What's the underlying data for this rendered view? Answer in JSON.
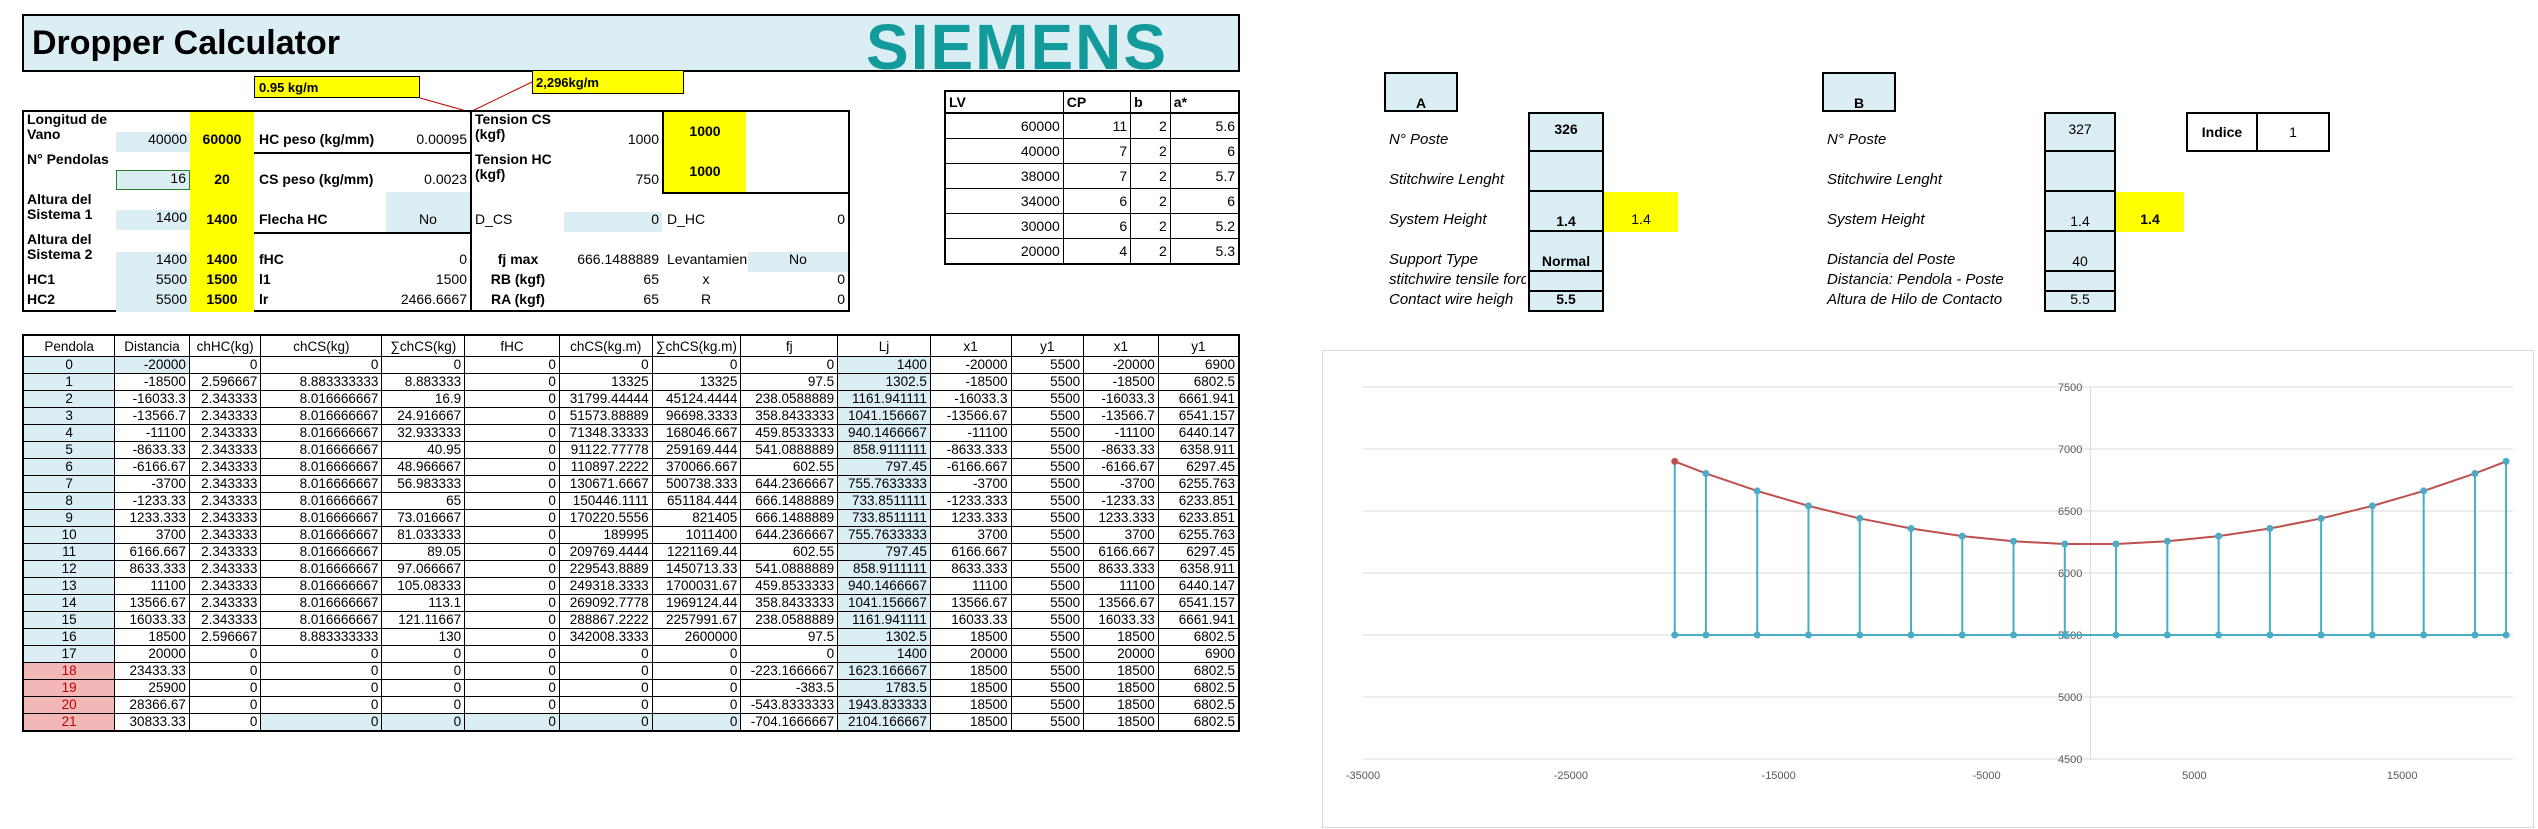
{
  "title": "Dropper Calculator",
  "brand": "SIEMENS",
  "colors": {
    "brand": "#139a9b",
    "cell_blue": "#dbeef4",
    "highlight": "#ffff00",
    "pink": "#f4b7b7",
    "line_blue": "#4bacc6",
    "curve_red": "#c0504d"
  },
  "callouts": {
    "weight_cs": "0.95 kg/m",
    "weight_hc": "2,296kg/m"
  },
  "params": {
    "span_label": "Longitud de Vano",
    "span_val": "40000",
    "span_in": "60000",
    "droppers_label": "N° Pendolas",
    "droppers_val": "16",
    "droppers_in": "20",
    "sys1_label": "Altura del Sistema 1",
    "sys1_val": "1400",
    "sys1_in": "1400",
    "sys2_label": "Altura del Sistema 2",
    "sys2_val": "1400",
    "sys2_in": "1400",
    "hc1_label": "HC1",
    "hc1_val": "5500",
    "hc1_in": "1500",
    "hc2_label": "HC2",
    "hc2_val": "5500",
    "hc2_in": "1500",
    "hc_peso_label": "HC peso (kg/mm)",
    "hc_peso_val": "0.00095",
    "cs_peso_label": "CS peso (kg/mm)",
    "cs_peso_val": "0.0023",
    "flecha_label": "Flecha HC",
    "flecha_val": "No",
    "fhc_label": "fHC",
    "fhc_val": "0",
    "l1_label": "l1",
    "l1_val": "1500",
    "lr_label": "lr",
    "lr_val": "2466.6667",
    "tcs_label": "Tension CS (kgf)",
    "tcs_val": "1000",
    "tcs_in": "1000",
    "thc_label": "Tension HC (kgf)",
    "thc_val": "750",
    "thc_in": "1000",
    "dcs_label": "D_CS",
    "dcs_val": "0",
    "fjmax_label": "fj max",
    "fjmax_val": "666.1488889",
    "rb_label": "RB (kgf)",
    "rb_val": "65",
    "ra_label": "RA (kgf)",
    "ra_val": "65",
    "dhc_label": "D_HC",
    "dhc_val": "0",
    "lev_label": "Levantamien",
    "lev_val": "No",
    "x_label": "x",
    "x_val": "0",
    "r_label": "R",
    "r_val": "0"
  },
  "lv_table": {
    "headers": [
      "LV",
      "CP",
      "b",
      "a*"
    ],
    "rows": [
      [
        "60000",
        "11",
        "2",
        "5.6"
      ],
      [
        "40000",
        "7",
        "2",
        "6"
      ],
      [
        "38000",
        "7",
        "2",
        "5.7"
      ],
      [
        "34000",
        "6",
        "2",
        "6"
      ],
      [
        "30000",
        "6",
        "2",
        "5.2"
      ],
      [
        "20000",
        "4",
        "2",
        "5.3"
      ]
    ]
  },
  "support_a": {
    "header": "A",
    "poste_label": "N° Poste",
    "poste_val": "326",
    "stitch_label": "Stitchwire Lenght",
    "height_label": "System Height",
    "height_val": "1.4",
    "height_yellow": "1.4",
    "type_label": "Support Type",
    "type_val": "Normal",
    "forces_label": "stitchwire tensile forces",
    "contact_label": "Contact wire heigh",
    "contact_val": "5.5"
  },
  "support_b": {
    "header": "B",
    "poste_label": "N° Poste",
    "poste_val": "327",
    "stitch_label": "Stitchwire Lenght",
    "height_label": "System Height",
    "height_val": "1.4",
    "height_yellow": "1.4",
    "dist_label": "Distancia del Poste",
    "dist_val": "40",
    "dist2_label": "Distancia: Pendola - Poste",
    "altura_label": "Altura de Hilo de Contacto",
    "altura_val": "5.5"
  },
  "indice": {
    "label": "Indice",
    "value": "1"
  },
  "table": {
    "headers": [
      "Pendola",
      "Distancia",
      "chHC(kg)",
      "chCS(kg)",
      "∑chCS(kg)",
      "fHC",
      "chCS(kg.m)",
      "∑chCS(kg.m)",
      "fj",
      "Lj",
      "x1",
      "y1",
      "x1",
      "y1"
    ],
    "rows": [
      [
        "0",
        "-20000",
        "0",
        "0",
        "0",
        "0",
        "0",
        "0",
        "0",
        "1400",
        "-20000",
        "5500",
        "-20000",
        "6900"
      ],
      [
        "1",
        "-18500",
        "2.596667",
        "8.883333333",
        "8.883333",
        "0",
        "13325",
        "13325",
        "97.5",
        "1302.5",
        "-18500",
        "5500",
        "-18500",
        "6802.5"
      ],
      [
        "2",
        "-16033.3",
        "2.343333",
        "8.016666667",
        "16.9",
        "0",
        "31799.44444",
        "45124.4444",
        "238.0588889",
        "1161.941111",
        "-16033.3",
        "5500",
        "-16033.3",
        "6661.941"
      ],
      [
        "3",
        "-13566.7",
        "2.343333",
        "8.016666667",
        "24.916667",
        "0",
        "51573.88889",
        "96698.3333",
        "358.8433333",
        "1041.156667",
        "-13566.67",
        "5500",
        "-13566.7",
        "6541.157"
      ],
      [
        "4",
        "-11100",
        "2.343333",
        "8.016666667",
        "32.933333",
        "0",
        "71348.33333",
        "168046.667",
        "459.8533333",
        "940.1466667",
        "-11100",
        "5500",
        "-11100",
        "6440.147"
      ],
      [
        "5",
        "-8633.33",
        "2.343333",
        "8.016666667",
        "40.95",
        "0",
        "91122.77778",
        "259169.444",
        "541.0888889",
        "858.9111111",
        "-8633.333",
        "5500",
        "-8633.33",
        "6358.911"
      ],
      [
        "6",
        "-6166.67",
        "2.343333",
        "8.016666667",
        "48.966667",
        "0",
        "110897.2222",
        "370066.667",
        "602.55",
        "797.45",
        "-6166.667",
        "5500",
        "-6166.67",
        "6297.45"
      ],
      [
        "7",
        "-3700",
        "2.343333",
        "8.016666667",
        "56.983333",
        "0",
        "130671.6667",
        "500738.333",
        "644.2366667",
        "755.7633333",
        "-3700",
        "5500",
        "-3700",
        "6255.763"
      ],
      [
        "8",
        "-1233.33",
        "2.343333",
        "8.016666667",
        "65",
        "0",
        "150446.1111",
        "651184.444",
        "666.1488889",
        "733.8511111",
        "-1233.333",
        "5500",
        "-1233.33",
        "6233.851"
      ],
      [
        "9",
        "1233.333",
        "2.343333",
        "8.016666667",
        "73.016667",
        "0",
        "170220.5556",
        "821405",
        "666.1488889",
        "733.8511111",
        "1233.333",
        "5500",
        "1233.333",
        "6233.851"
      ],
      [
        "10",
        "3700",
        "2.343333",
        "8.016666667",
        "81.033333",
        "0",
        "189995",
        "1011400",
        "644.2366667",
        "755.7633333",
        "3700",
        "5500",
        "3700",
        "6255.763"
      ],
      [
        "11",
        "6166.667",
        "2.343333",
        "8.016666667",
        "89.05",
        "0",
        "209769.4444",
        "1221169.44",
        "602.55",
        "797.45",
        "6166.667",
        "5500",
        "6166.667",
        "6297.45"
      ],
      [
        "12",
        "8633.333",
        "2.343333",
        "8.016666667",
        "97.066667",
        "0",
        "229543.8889",
        "1450713.33",
        "541.0888889",
        "858.9111111",
        "8633.333",
        "5500",
        "8633.333",
        "6358.911"
      ],
      [
        "13",
        "11100",
        "2.343333",
        "8.016666667",
        "105.08333",
        "0",
        "249318.3333",
        "1700031.67",
        "459.8533333",
        "940.1466667",
        "11100",
        "5500",
        "11100",
        "6440.147"
      ],
      [
        "14",
        "13566.67",
        "2.343333",
        "8.016666667",
        "113.1",
        "0",
        "269092.7778",
        "1969124.44",
        "358.8433333",
        "1041.156667",
        "13566.67",
        "5500",
        "13566.67",
        "6541.157"
      ],
      [
        "15",
        "16033.33",
        "2.343333",
        "8.016666667",
        "121.11667",
        "0",
        "288867.2222",
        "2257991.67",
        "238.0588889",
        "1161.941111",
        "16033.33",
        "5500",
        "16033.33",
        "6661.941"
      ],
      [
        "16",
        "18500",
        "2.596667",
        "8.883333333",
        "130",
        "0",
        "342008.3333",
        "2600000",
        "97.5",
        "1302.5",
        "18500",
        "5500",
        "18500",
        "6802.5"
      ],
      [
        "17",
        "20000",
        "0",
        "0",
        "0",
        "0",
        "0",
        "0",
        "0",
        "1400",
        "20000",
        "5500",
        "20000",
        "6900"
      ],
      [
        "18",
        "23433.33",
        "0",
        "0",
        "0",
        "0",
        "0",
        "0",
        "-223.1666667",
        "1623.166667",
        "18500",
        "5500",
        "18500",
        "6802.5"
      ],
      [
        "19",
        "25900",
        "0",
        "0",
        "0",
        "0",
        "0",
        "0",
        "-383.5",
        "1783.5",
        "18500",
        "5500",
        "18500",
        "6802.5"
      ],
      [
        "20",
        "28366.67",
        "0",
        "0",
        "0",
        "0",
        "0",
        "0",
        "-543.8333333",
        "1943.833333",
        "18500",
        "5500",
        "18500",
        "6802.5"
      ],
      [
        "21",
        "30833.33",
        "0",
        "0",
        "0",
        "0",
        "0",
        "0",
        "-704.1666667",
        "2104.166667",
        "18500",
        "5500",
        "18500",
        "6802.5"
      ]
    ]
  },
  "chart_data": {
    "type": "line",
    "xlim": [
      -35000,
      20000
    ],
    "ylim": [
      4500,
      7500
    ],
    "x_ticks": [
      "-35000",
      "-25000",
      "-15000",
      "-5000",
      "5000",
      "15000"
    ],
    "y_ticks": [
      "7500",
      "7000",
      "6500",
      "6000",
      "5500",
      "5000",
      "4500"
    ],
    "series": [
      {
        "x": [
          -20000,
          -18500,
          -16033.3,
          -13566.7,
          -11100,
          -8633.33,
          -6166.67,
          -3700,
          -1233.33,
          1233.333,
          3700,
          6166.667,
          8633.333,
          11100,
          13566.67,
          16033.33,
          18500,
          20000
        ],
        "y": [
          5500,
          5500,
          5500,
          5500,
          5500,
          5500,
          5500,
          5500,
          5500,
          5500,
          5500,
          5500,
          5500,
          5500,
          5500,
          5500,
          5500,
          5500
        ]
      },
      {
        "x": [
          -20000,
          -18500,
          -16033.3,
          -13566.7,
          -11100,
          -8633.33,
          -6166.67,
          -3700,
          -1233.33,
          1233.333,
          3700,
          6166.667,
          8633.333,
          11100,
          13566.67,
          16033.33,
          18500,
          20000
        ],
        "y": [
          6900,
          6802.5,
          6661.941,
          6541.157,
          6440.147,
          6358.911,
          6297.45,
          6255.763,
          6233.851,
          6233.851,
          6255.763,
          6297.45,
          6358.911,
          6440.147,
          6541.157,
          6661.941,
          6802.5,
          6900
        ]
      }
    ],
    "grid": "horizontal",
    "legend": "none"
  }
}
